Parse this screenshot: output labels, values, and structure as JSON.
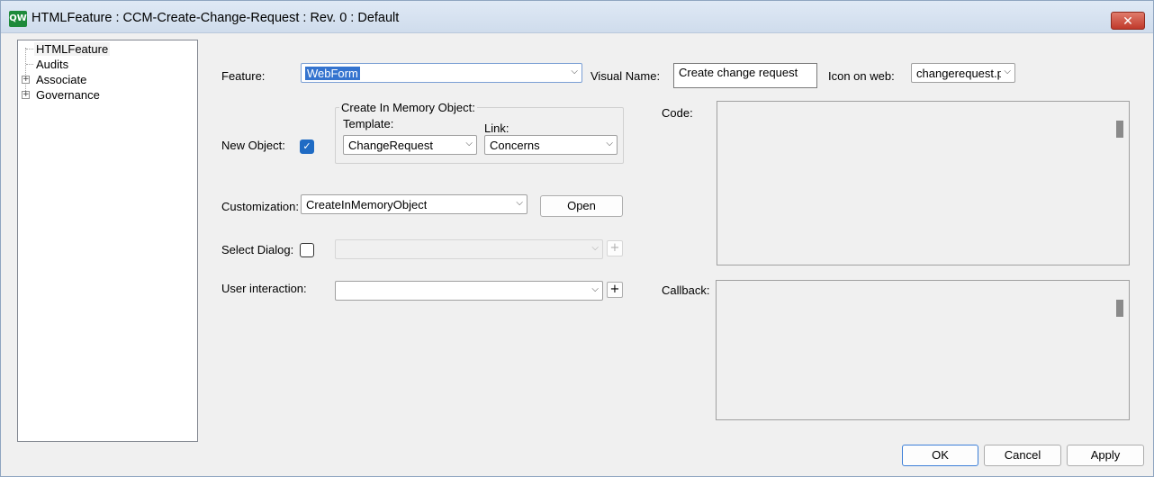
{
  "window": {
    "app_icon": "QW",
    "title": "HTMLFeature : CCM-Create-Change-Request : Rev. 0  : Default",
    "close_label": "✕"
  },
  "tree": {
    "items": [
      {
        "label": "HTMLFeature",
        "expandable": false,
        "selected": true
      },
      {
        "label": "Audits",
        "expandable": false,
        "selected": false
      },
      {
        "label": "Associate",
        "expandable": true,
        "selected": false
      },
      {
        "label": "Governance",
        "expandable": true,
        "selected": false
      }
    ],
    "expander_symbol": "+"
  },
  "form": {
    "feature_label": "Feature:",
    "feature_value": "WebForm",
    "visual_name_label": "Visual Name:",
    "visual_name_value": "Create change request",
    "icon_on_web_label": "Icon on web:",
    "icon_on_web_value": "changerequest.p",
    "new_object_label": "New Object:",
    "new_object_checked": true,
    "create_in_memory_title": "Create In Memory Object:",
    "template_label": "Template:",
    "template_value": "ChangeRequest",
    "link_label": "Link:",
    "link_value": "Concerns",
    "customization_label": "Customization:",
    "customization_value": "CreateInMemoryObject",
    "open_label": "Open",
    "select_dialog_label": "Select Dialog:",
    "select_dialog_checked": false,
    "select_dialog_value": "",
    "user_interaction_label": "User interaction:",
    "user_interaction_value": "",
    "plus_label": "+",
    "code_label": "Code:",
    "callback_label": "Callback:",
    "dropdown_arrow": "⌵",
    "check_mark": "✓"
  },
  "footer": {
    "ok_label": "OK",
    "cancel_label": "Cancel",
    "apply_label": "Apply"
  }
}
